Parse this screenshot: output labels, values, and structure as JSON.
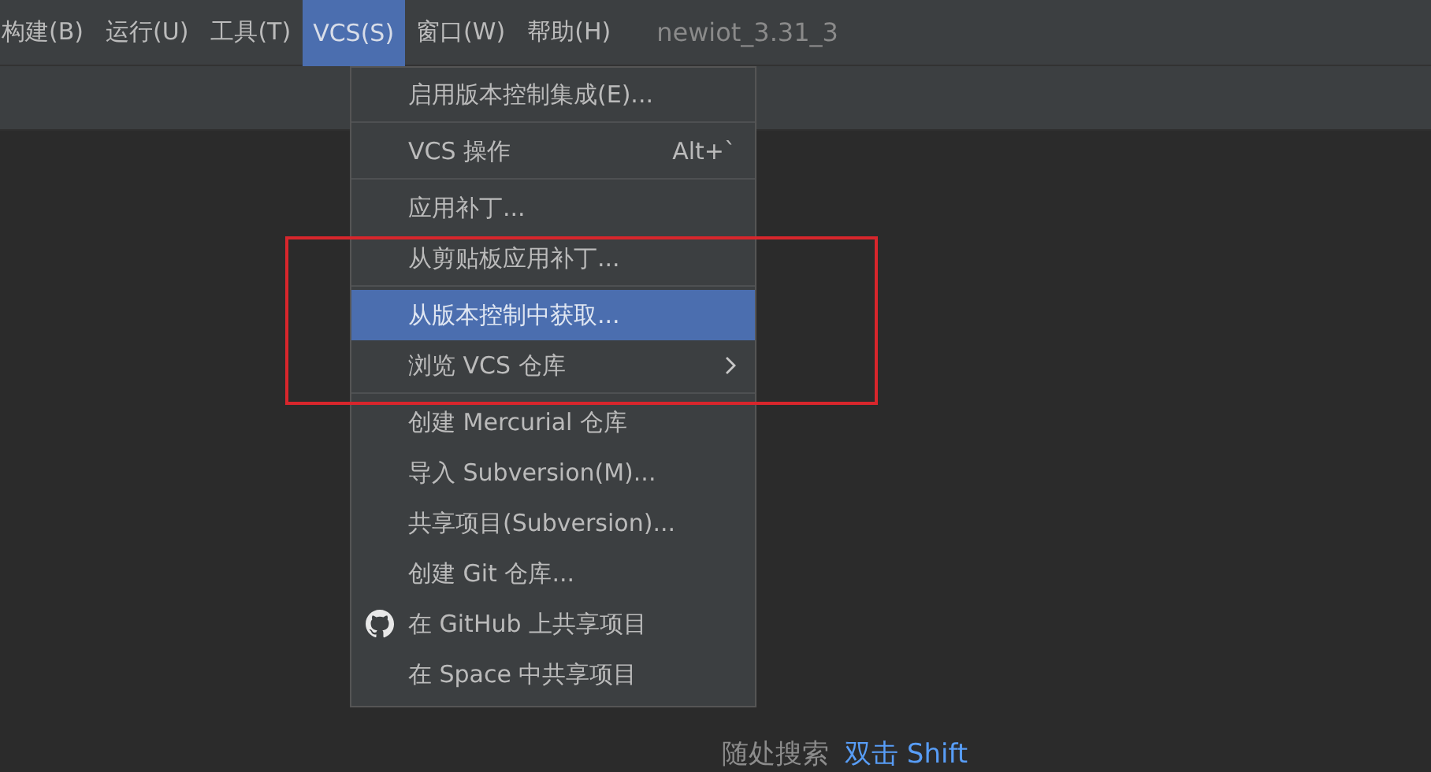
{
  "menu_bar": {
    "items": [
      {
        "label": "构建(B)",
        "selected": false
      },
      {
        "label": "运行(U)",
        "selected": false
      },
      {
        "label": "工具(T)",
        "selected": false
      },
      {
        "label": "VCS(S)",
        "selected": true
      },
      {
        "label": "窗口(W)",
        "selected": false
      },
      {
        "label": "帮助(H)",
        "selected": false
      }
    ],
    "project_title": "newiot_3.31_3"
  },
  "vcs_menu": {
    "items": [
      {
        "kind": "item",
        "label": "启用版本控制集成(E)...",
        "selected": false
      },
      {
        "kind": "separator"
      },
      {
        "kind": "item",
        "label": "VCS 操作",
        "shortcut": "Alt+`",
        "selected": false
      },
      {
        "kind": "separator"
      },
      {
        "kind": "item",
        "label": "应用补丁...",
        "selected": false
      },
      {
        "kind": "item",
        "label": "从剪贴板应用补丁...",
        "selected": false
      },
      {
        "kind": "separator"
      },
      {
        "kind": "item",
        "label": "从版本控制中获取...",
        "selected": true
      },
      {
        "kind": "item",
        "label": "浏览 VCS 仓库",
        "submenu": true,
        "selected": false
      },
      {
        "kind": "separator"
      },
      {
        "kind": "item",
        "label": "创建 Mercurial 仓库",
        "selected": false
      },
      {
        "kind": "item",
        "label": "导入 Subversion(M)...",
        "selected": false
      },
      {
        "kind": "item",
        "label": "共享项目(Subversion)...",
        "selected": false
      },
      {
        "kind": "item",
        "label": "创建 Git 仓库...",
        "selected": false
      },
      {
        "kind": "github_item",
        "label": "在 GitHub 上共享项目",
        "selected": false
      },
      {
        "kind": "item",
        "label": "在 Space 中共享项目",
        "selected": false
      }
    ]
  },
  "editor_hint": {
    "label": "随处搜索",
    "shortcut": "双击 Shift"
  }
}
